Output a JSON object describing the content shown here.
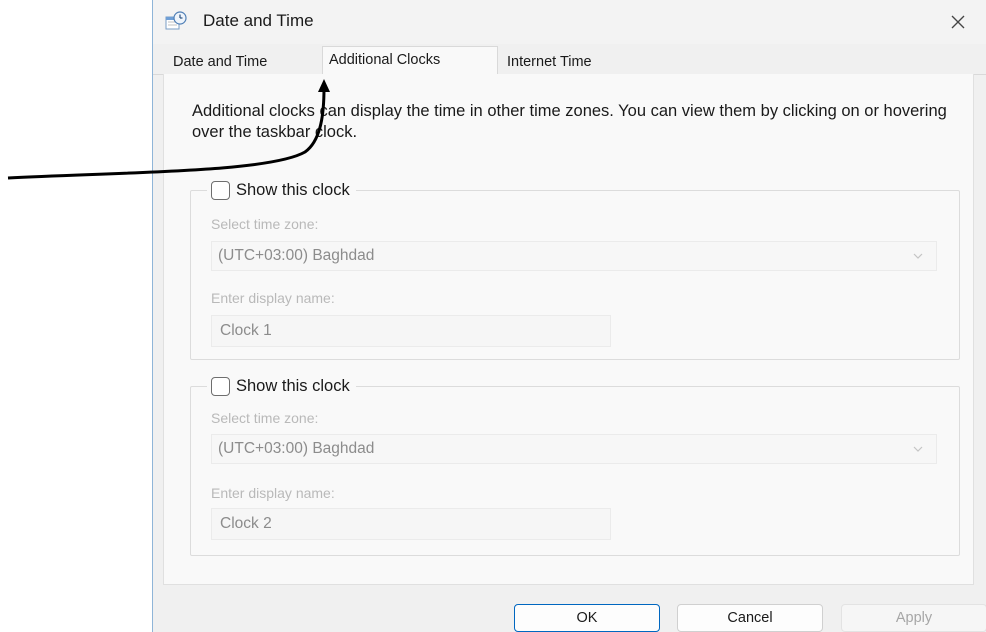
{
  "window": {
    "title": "Date and Time",
    "close_glyph": "✕",
    "icon": "date-time-control-panel-icon"
  },
  "tabs": [
    {
      "label": "Date and Time",
      "active": false
    },
    {
      "label": "Additional Clocks",
      "active": true
    },
    {
      "label": "Internet Time",
      "active": false
    }
  ],
  "description": "Additional clocks can display the time in other time zones. You can view them by clicking on or hovering over the taskbar clock.",
  "clocks": [
    {
      "show_label": "Show this clock",
      "checked": false,
      "timezone_label": "Select time zone:",
      "timezone_value": "(UTC+03:00) Baghdad",
      "name_label": "Enter display name:",
      "name_value": "Clock 1"
    },
    {
      "show_label": "Show this clock",
      "checked": false,
      "timezone_label": "Select time zone:",
      "timezone_value": "(UTC+03:00) Baghdad",
      "name_label": "Enter display name:",
      "name_value": "Clock 2"
    }
  ],
  "buttons": {
    "ok": "OK",
    "cancel": "Cancel",
    "apply": "Apply"
  },
  "colors": {
    "accent": "#0067c0",
    "window_border": "#8fb5d8",
    "annotation_arrow": "#000000"
  }
}
